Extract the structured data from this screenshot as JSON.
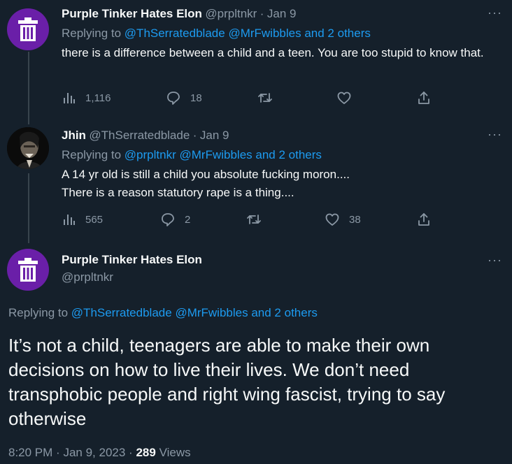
{
  "tweets": [
    {
      "name": "Purple Tinker Hates Elon",
      "handle": "@prpltnkr",
      "sep": "·",
      "date": "Jan 9",
      "replying_label": "Replying to",
      "reply_handles": [
        "@ThSerratedblade",
        "@MrFwibbles"
      ],
      "reply_others": "and 2 others",
      "text": "there is a difference between a child and a teen. You are too stupid to know that.",
      "views": "1,116",
      "replies": "18",
      "retweets": "",
      "likes": ""
    },
    {
      "name": "Jhin",
      "handle": "@ThSerratedblade",
      "sep": "·",
      "date": "Jan 9",
      "replying_label": "Replying to",
      "reply_handles": [
        "@prpltnkr",
        "@MrFwibbles"
      ],
      "reply_others": "and 2 others",
      "text_lines": [
        "A 14 yr old is still a child you absolute fucking moron....",
        "There is a reason statutory rape is a thing...."
      ],
      "views": "565",
      "replies": "2",
      "retweets": "",
      "likes": "38"
    }
  ],
  "main": {
    "name": "Purple Tinker Hates Elon",
    "handle": "@prpltnkr",
    "replying_label": "Replying to",
    "reply_handles": [
      "@ThSerratedblade",
      "@MrFwibbles"
    ],
    "reply_others": "and 2 others",
    "text": "It’s not a child, teenagers are able to make their own decisions on how to live their lives. We don’t need transphobic people and right wing fascist, trying to say otherwise",
    "time": "8:20 PM",
    "sep": "·",
    "date": "Jan 9, 2023",
    "sep2": "·",
    "views_count": "289",
    "views_label": "Views"
  },
  "more_glyph": "···",
  "colors": {
    "background": "#15202b",
    "accent": "#1d9bf0",
    "muted": "#8b98a5",
    "avatar_purple": "#6a1fa8"
  },
  "icons": [
    "trash-can-icon",
    "views-icon",
    "reply-icon",
    "retweet-icon",
    "like-icon",
    "share-icon",
    "more-icon"
  ]
}
